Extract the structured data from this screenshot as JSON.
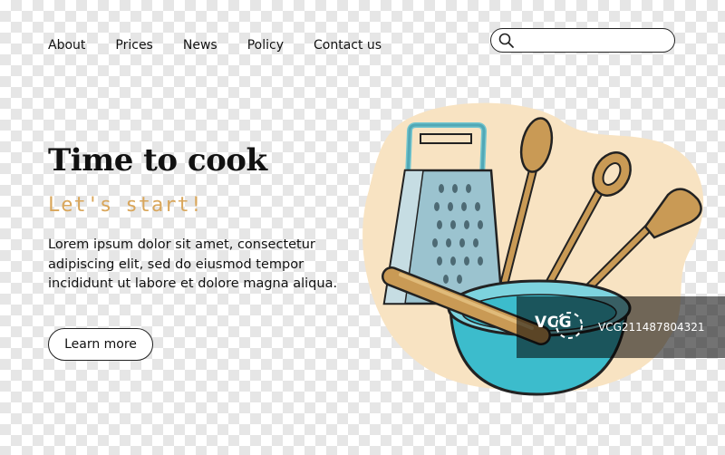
{
  "nav": {
    "items": [
      {
        "label": "About"
      },
      {
        "label": "Prices"
      },
      {
        "label": "News"
      },
      {
        "label": "Policy"
      },
      {
        "label": "Contact us"
      }
    ]
  },
  "search": {
    "placeholder": "",
    "value": "",
    "icon": "search-icon"
  },
  "hero": {
    "title": "Time to cook",
    "subtitle": "Let's start!",
    "body": "Lorem ipsum dolor sit amet, consectetur adipiscing elit, sed do eiusmod tempor incididunt ut labore et dolore magna aliqua.",
    "button_label": "Learn more"
  },
  "illustration": {
    "items": [
      "grater-icon",
      "wooden-spoon-icon",
      "pasta-spoon-icon",
      "spatula-icon",
      "rolling-pin-icon",
      "bowl-icon"
    ],
    "colors": {
      "blob": "#f8e3c2",
      "metal": "#9bc3cf",
      "wood": "#c99a55",
      "bowl": "#3cbccc",
      "outline": "#222222"
    }
  },
  "watermark": {
    "logo_text": "VCG",
    "id_text": "VCG211487804321"
  },
  "colors": {
    "accent": "#d9a65a",
    "text": "#111111"
  }
}
